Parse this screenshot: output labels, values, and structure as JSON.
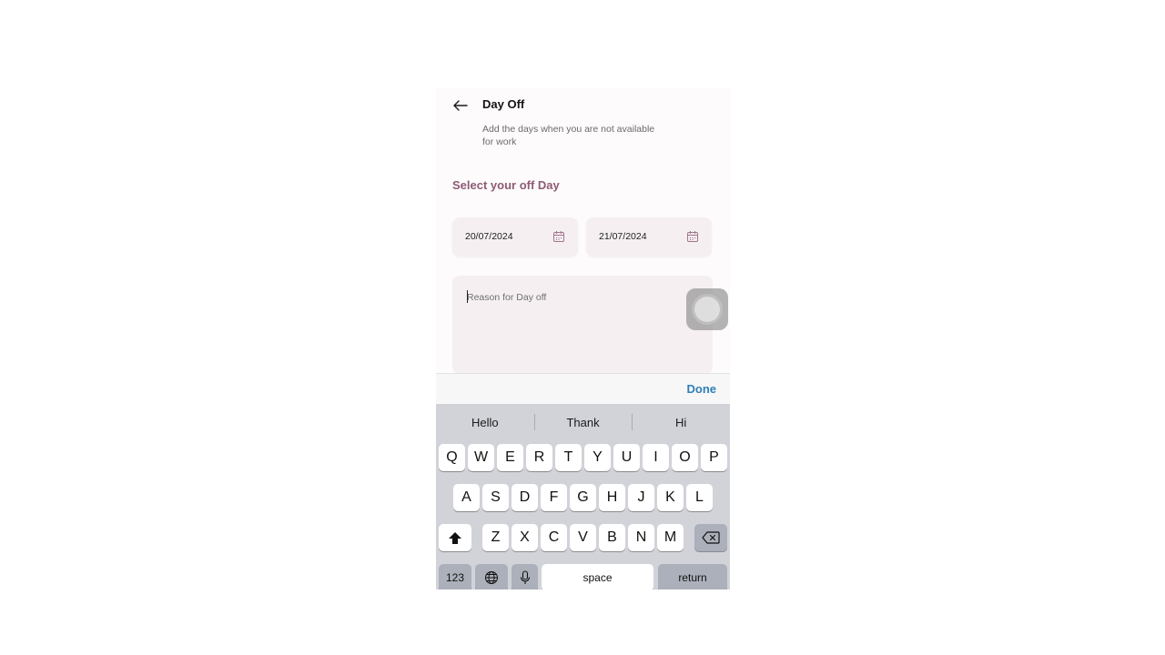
{
  "header": {
    "title": "Day Off",
    "subtitle": "Add the days when you are not available for work"
  },
  "section": {
    "heading": "Select your off Day"
  },
  "dates": {
    "start": "20/07/2024",
    "end": "21/07/2024"
  },
  "reason": {
    "placeholder": "Reason for Day off",
    "value": ""
  },
  "toolbar": {
    "done_label": "Done"
  },
  "keyboard": {
    "suggestions": [
      "Hello",
      "Thank",
      "Hi"
    ],
    "row1": [
      "Q",
      "W",
      "E",
      "R",
      "T",
      "Y",
      "U",
      "I",
      "O",
      "P"
    ],
    "row2": [
      "A",
      "S",
      "D",
      "F",
      "G",
      "H",
      "J",
      "K",
      "L"
    ],
    "row3": [
      "Z",
      "X",
      "C",
      "V",
      "B",
      "N",
      "M"
    ],
    "numbers_label": "123",
    "space_label": "space",
    "return_label": "return"
  },
  "colors": {
    "accent_heading": "#8e5b74",
    "done_blue": "#2f7fb8",
    "field_bg": "#f5eff2"
  },
  "icons": {
    "back": "arrow-left-icon",
    "calendar": "calendar-icon",
    "shift": "shift-icon",
    "delete": "backspace-icon",
    "globe": "globe-icon",
    "mic": "microphone-icon"
  }
}
